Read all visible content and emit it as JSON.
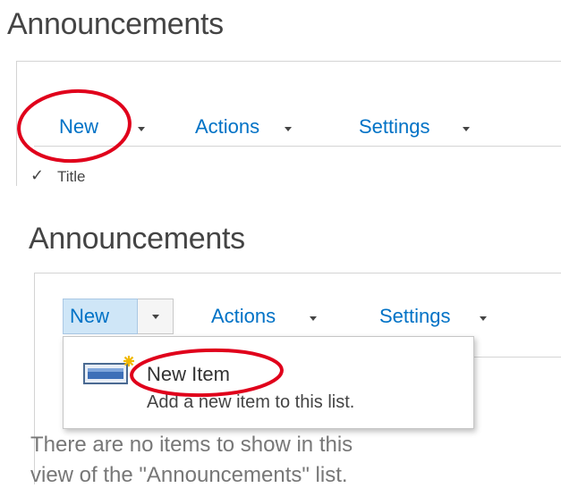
{
  "panel1": {
    "title": "Announcements",
    "toolbar": {
      "new_label": "New",
      "actions_label": "Actions",
      "settings_label": "Settings"
    },
    "list": {
      "check_glyph": "✓",
      "column_title": "Title"
    }
  },
  "panel2": {
    "title": "Announcements",
    "toolbar": {
      "new_label": "New",
      "actions_label": "Actions",
      "settings_label": "Settings"
    },
    "dropdown": {
      "icon": "new-item-icon",
      "item_label": "New Item",
      "item_description": "Add a new item to this list."
    },
    "empty_message_line1": "There are no items to show in this",
    "empty_message_line2": "view of the \"Announcements\" list."
  },
  "colors": {
    "link": "#0072c6",
    "annotation": "#e0001b",
    "selected_button_bg": "#cfe6f7"
  }
}
